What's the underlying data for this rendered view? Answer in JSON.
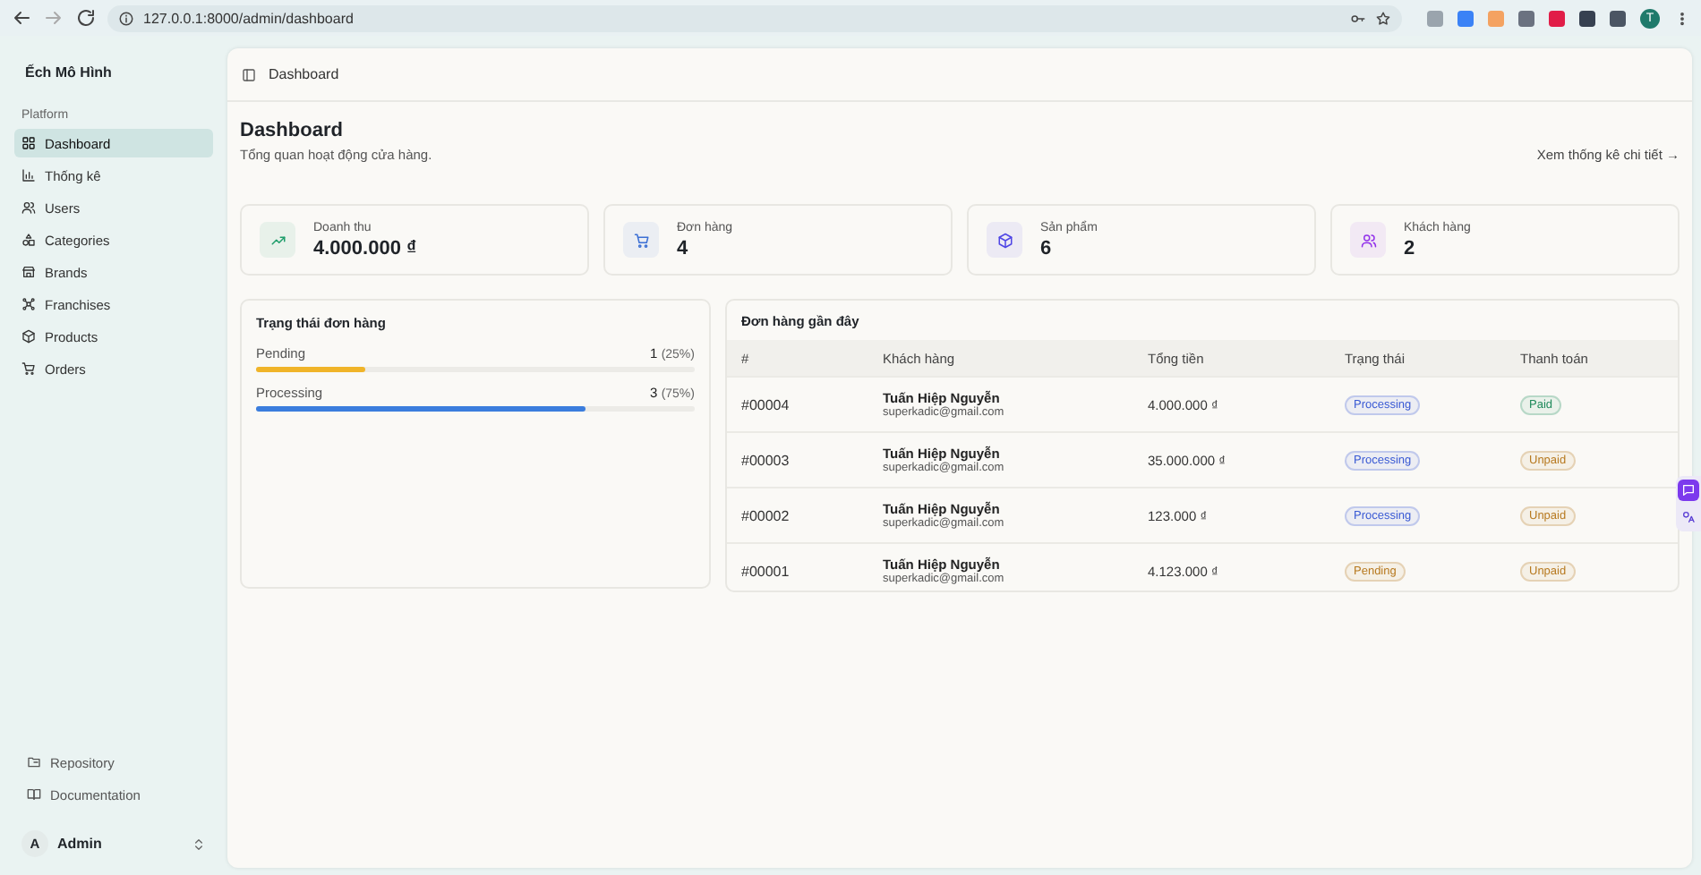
{
  "browser": {
    "url": "127.0.0.1:8000/admin/dashboard",
    "avatar": "T"
  },
  "sidebar": {
    "brand": "Ếch Mô Hình",
    "section": "Platform",
    "items": [
      {
        "label": "Dashboard",
        "selected": true
      },
      {
        "label": "Thống kê",
        "selected": false
      },
      {
        "label": "Users",
        "selected": false
      },
      {
        "label": "Categories",
        "selected": false
      },
      {
        "label": "Brands",
        "selected": false
      },
      {
        "label": "Franchises",
        "selected": false
      },
      {
        "label": "Products",
        "selected": false
      },
      {
        "label": "Orders",
        "selected": false
      }
    ],
    "footer_links": [
      {
        "label": "Repository"
      },
      {
        "label": "Documentation"
      }
    ],
    "user": {
      "initial": "A",
      "name": "Admin"
    }
  },
  "breadcrumb": "Dashboard",
  "page": {
    "title": "Dashboard",
    "subtitle": "Tổng quan hoạt động cửa hàng.",
    "link": "Xem thống kê chi tiết →"
  },
  "stats": [
    {
      "label": "Doanh thu",
      "value": "4.000.000 ₫",
      "color": "#1f9d6b"
    },
    {
      "label": "Đơn hàng",
      "value": "4",
      "color": "#3b6fd4"
    },
    {
      "label": "Sản phẩm",
      "value": "6",
      "color": "#4f46e5"
    },
    {
      "label": "Khách hàng",
      "value": "2",
      "color": "#9333ea"
    }
  ],
  "order_status": {
    "title": "Trạng thái đơn hàng",
    "rows": [
      {
        "label": "Pending",
        "count": "1",
        "percent": "(25%)",
        "level": 0.25,
        "color": "#f0b429"
      },
      {
        "label": "Processing",
        "count": "3",
        "percent": "(75%)",
        "level": 0.75,
        "color": "#3b7ddd"
      }
    ]
  },
  "recent_orders": {
    "title": "Đơn hàng gần đây",
    "columns": [
      "#",
      "Khách hàng",
      "Tổng tiền",
      "Trạng thái",
      "Thanh toán"
    ],
    "rows": [
      {
        "id": "#00004",
        "name": "Tuấn Hiệp Nguyễn",
        "email": "superkadic@gmail.com",
        "total": "4.000.000 ₫",
        "status": {
          "text": "Processing",
          "color": "#3b5bd4"
        },
        "payment": {
          "text": "Paid",
          "color": "#1f8a5b"
        }
      },
      {
        "id": "#00003",
        "name": "Tuấn Hiệp Nguyễn",
        "email": "superkadic@gmail.com",
        "total": "35.000.000 ₫",
        "status": {
          "text": "Processing",
          "color": "#3b5bd4"
        },
        "payment": {
          "text": "Unpaid",
          "color": "#b7791f"
        }
      },
      {
        "id": "#00002",
        "name": "Tuấn Hiệp Nguyễn",
        "email": "superkadic@gmail.com",
        "total": "123.000 ₫",
        "status": {
          "text": "Processing",
          "color": "#3b5bd4"
        },
        "payment": {
          "text": "Unpaid",
          "color": "#b7791f"
        }
      },
      {
        "id": "#00001",
        "name": "Tuấn Hiệp Nguyễn",
        "email": "superkadic@gmail.com",
        "total": "4.123.000 ₫",
        "status": {
          "text": "Pending",
          "color": "#b7791f"
        },
        "payment": {
          "text": "Unpaid",
          "color": "#b7791f"
        }
      }
    ]
  }
}
